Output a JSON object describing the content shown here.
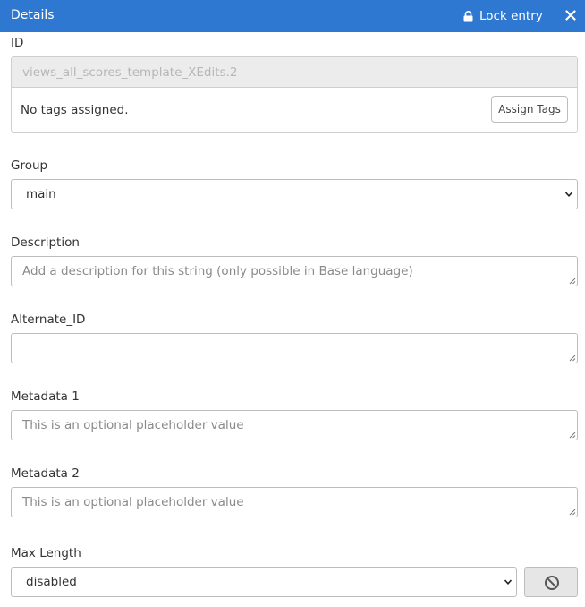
{
  "header": {
    "title": "Details",
    "lock_label": "Lock entry",
    "lock_icon": "lock-icon",
    "close_icon": "close-icon"
  },
  "id_section": {
    "label": "ID",
    "value": "views_all_scores_template_XEdits.2",
    "tags_text": "No tags assigned.",
    "assign_tags_label": "Assign Tags"
  },
  "group": {
    "label": "Group",
    "selected": "main"
  },
  "description": {
    "label": "Description",
    "placeholder": "Add a description for this string (only possible in Base language)"
  },
  "alternate_id": {
    "label": "Alternate_ID",
    "placeholder": ""
  },
  "metadata_1": {
    "label": "Metadata 1",
    "placeholder": "This is an optional placeholder value"
  },
  "metadata_2": {
    "label": "Metadata 2",
    "placeholder": "This is an optional placeholder value"
  },
  "max_length": {
    "label": "Max Length",
    "selected": "disabled",
    "disable_icon": "ban-icon"
  },
  "colors": {
    "header_bg": "#2f78d1",
    "header_text": "#ffffff",
    "readonly_bg": "#ececec"
  }
}
